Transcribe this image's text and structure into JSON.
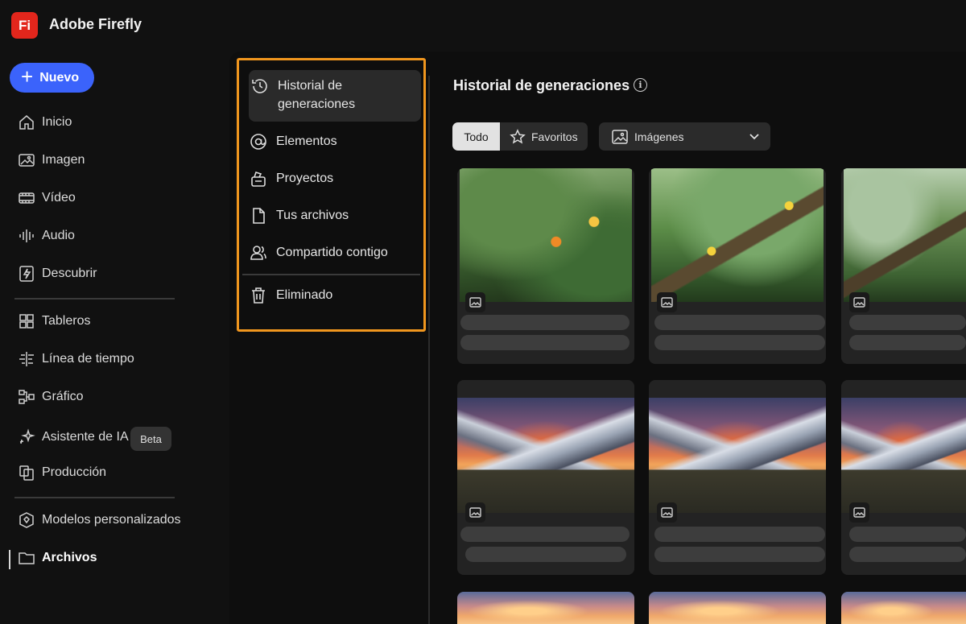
{
  "app": {
    "logo_text": "Fi",
    "title": "Adobe Firefly"
  },
  "sidebar": {
    "new_button": "Nuevo",
    "items": [
      {
        "label": "Inicio",
        "icon": "home-icon"
      },
      {
        "label": "Imagen",
        "icon": "image-icon"
      },
      {
        "label": "Vídeo",
        "icon": "video-icon"
      },
      {
        "label": "Audio",
        "icon": "audio-icon"
      },
      {
        "label": "Descubrir",
        "icon": "discover-icon"
      },
      {
        "label": "Tableros",
        "icon": "boards-icon"
      },
      {
        "label": "Línea de tiempo",
        "icon": "timeline-icon"
      },
      {
        "label": "Gráfico",
        "icon": "graph-icon"
      },
      {
        "label": "Asistente de IA",
        "icon": "ai-assistant-icon"
      },
      {
        "label": "Producción",
        "icon": "production-icon"
      },
      {
        "label": "Modelos personalizados",
        "icon": "custom-models-icon"
      },
      {
        "label": "Archivos",
        "icon": "folder-icon",
        "active": true
      }
    ],
    "beta_badge": "Beta"
  },
  "files_nav": {
    "items": [
      {
        "label": "Historial de generaciones",
        "icon": "history-icon",
        "selected": true
      },
      {
        "label": "Elementos",
        "icon": "at-icon"
      },
      {
        "label": "Proyectos",
        "icon": "projects-icon"
      },
      {
        "label": "Tus archivos",
        "icon": "file-icon"
      },
      {
        "label": "Compartido contigo",
        "icon": "shared-icon"
      },
      {
        "label": "Eliminado",
        "icon": "trash-icon"
      }
    ],
    "highlight_color": "#f0961e"
  },
  "content": {
    "title": "Historial de generaciones",
    "filters": {
      "all": "Todo",
      "favorites": "Favoritos"
    },
    "type_dropdown": "Imágenes",
    "cards": [
      {
        "image": "toucans-on-branch"
      },
      {
        "image": "toucans-on-mossy-branch"
      },
      {
        "image": "toucan-in-forest"
      },
      {
        "image": "mountain-sunset-camp"
      },
      {
        "image": "mountain-sunset-camp"
      },
      {
        "image": "mountain-sunset-camp"
      },
      {
        "image": "sunset-sky"
      },
      {
        "image": "sunset-sky"
      },
      {
        "image": "sunset-sky"
      }
    ]
  },
  "colors": {
    "accent": "#3b63fb",
    "brand": "#e3261c",
    "background": "#111111"
  }
}
